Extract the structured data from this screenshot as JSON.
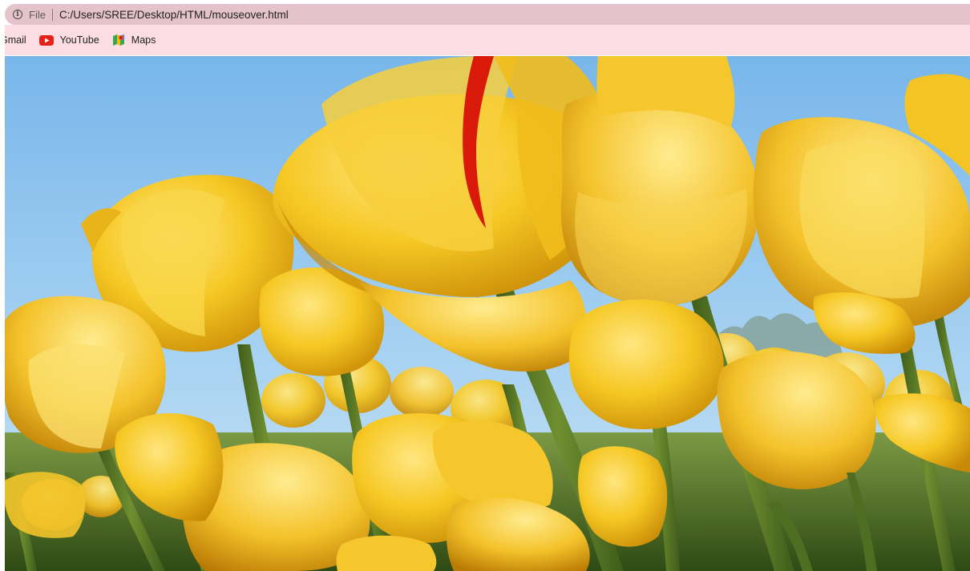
{
  "address_bar": {
    "scheme_label": "File",
    "url": "C:/Users/SREE/Desktop/HTML/mouseover.html",
    "background_color": "#e4c3ca"
  },
  "bookmarks_bar": {
    "background_color": "#fbdde3",
    "items": [
      {
        "label": "Gmail",
        "icon": "none"
      },
      {
        "label": "YouTube",
        "icon": "youtube-icon"
      },
      {
        "label": "Maps",
        "icon": "maps-icon"
      }
    ]
  },
  "page_content": {
    "image": "yellow-tulips-photo",
    "colors": {
      "sky": "#8cc4ef",
      "petal": "#f2c12a",
      "stem": "#5c7a2a"
    }
  }
}
